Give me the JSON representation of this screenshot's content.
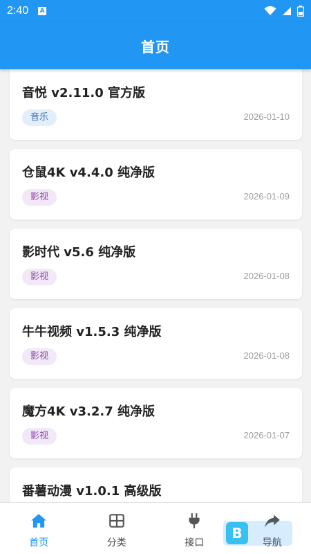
{
  "status_bar": {
    "time": "2:40",
    "notification_icon": "A"
  },
  "app_bar": {
    "title": "首页"
  },
  "items": [
    {
      "name": "音悦 v2.11.0 官方版",
      "tag": "音乐",
      "tag_type": "music",
      "date": "2026-01-10"
    },
    {
      "name": "仓鼠4K v4.4.0 纯净版",
      "tag": "影视",
      "tag_type": "video",
      "date": "2026-01-09"
    },
    {
      "name": "影时代 v5.6 纯净版",
      "tag": "影视",
      "tag_type": "video",
      "date": "2026-01-08"
    },
    {
      "name": "牛牛视频 v1.5.3 纯净版",
      "tag": "影视",
      "tag_type": "video",
      "date": "2026-01-08"
    },
    {
      "name": "魔方4K v3.2.7 纯净版",
      "tag": "影视",
      "tag_type": "video",
      "date": "2026-01-07"
    },
    {
      "name": "番薯动漫 v1.0.1 高级版",
      "tag": "",
      "tag_type": "video",
      "date": ""
    }
  ],
  "bottom_nav": [
    {
      "label": "首页",
      "icon": "home-icon",
      "active": true
    },
    {
      "label": "分类",
      "icon": "grid-icon",
      "active": false
    },
    {
      "label": "接口",
      "icon": "plug-icon",
      "active": false
    },
    {
      "label": "导航",
      "icon": "share-icon",
      "active": false
    }
  ],
  "colors": {
    "primary": "#2196f3",
    "music_tag_bg": "#e3eefb",
    "video_tag_bg": "#f2e8f7"
  }
}
